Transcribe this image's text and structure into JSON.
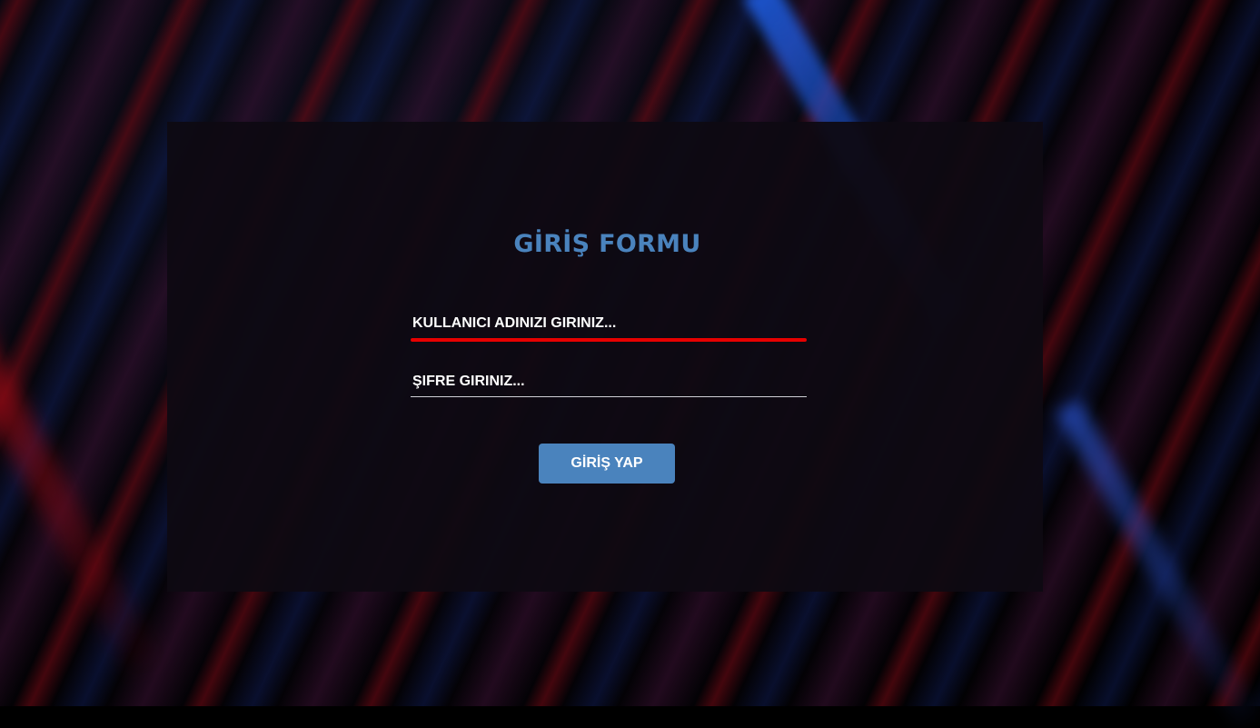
{
  "form": {
    "title": "GİRİŞ FORMU",
    "username_placeholder": "KULLANICI ADINIZI GIRINIZ...",
    "password_placeholder": "ŞIFRE GIRINIZ...",
    "submit_label": "GİRİŞ YAP"
  },
  "colors": {
    "accent": "#4a83bd",
    "focus_underline": "#e60000",
    "panel": "#0e0a12"
  }
}
